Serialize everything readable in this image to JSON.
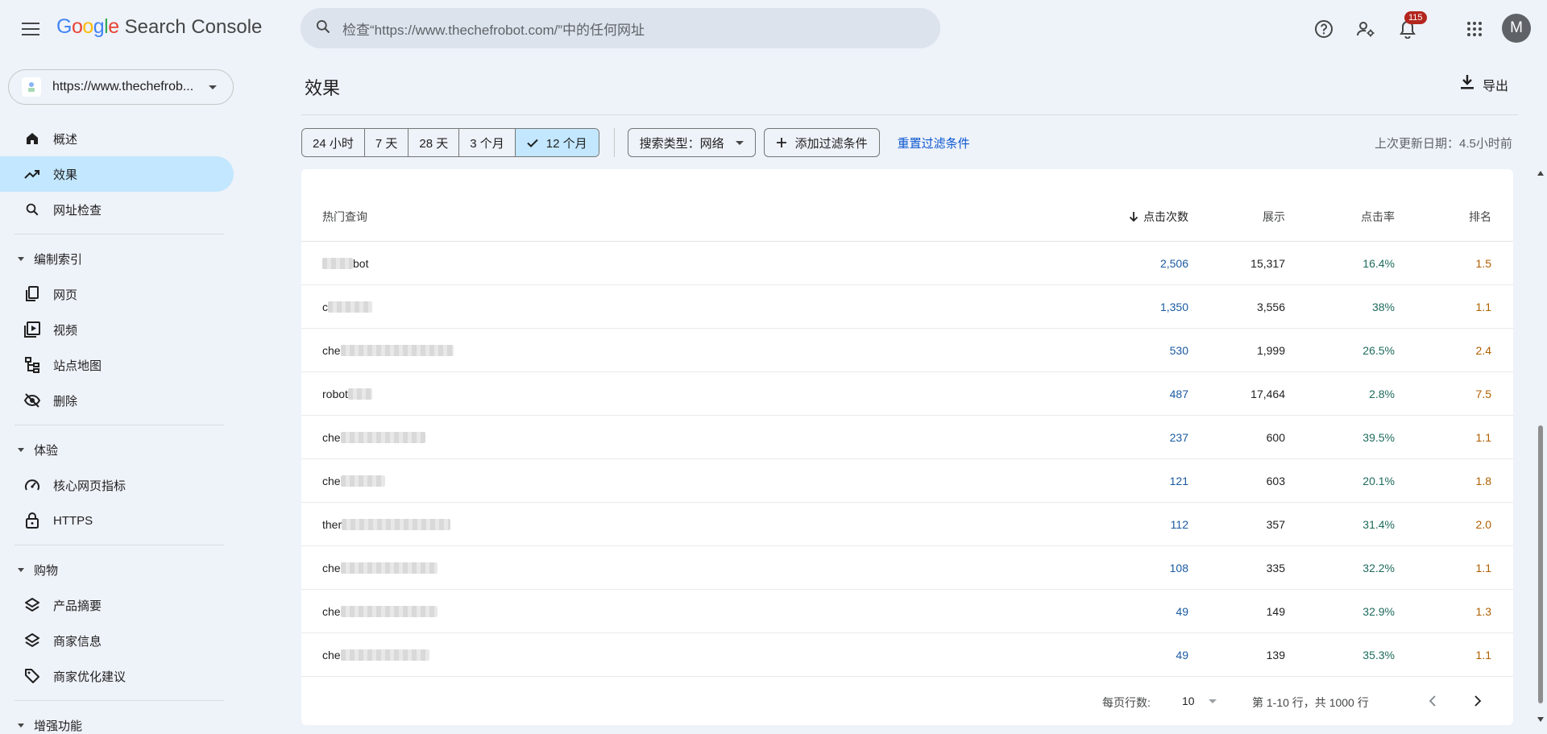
{
  "header": {
    "logo_google": "Google",
    "logo_product": "Search Console",
    "search_placeholder": "检查“https://www.thechefrobot.com/”中的任何网址",
    "notification_count": "115",
    "avatar_letter": "M"
  },
  "sidebar": {
    "property": "https://www.thechefrob...",
    "items_top": [
      {
        "label": "概述",
        "icon": "home-icon"
      },
      {
        "label": "效果",
        "icon": "trending-up-icon"
      },
      {
        "label": "网址检查",
        "icon": "search-icon"
      }
    ],
    "sections": [
      {
        "title": "编制索引",
        "items": [
          {
            "label": "网页",
            "icon": "pages-icon"
          },
          {
            "label": "视频",
            "icon": "video-icon"
          },
          {
            "label": "站点地图",
            "icon": "sitemap-icon"
          },
          {
            "label": "删除",
            "icon": "eye-off-icon"
          }
        ]
      },
      {
        "title": "体验",
        "items": [
          {
            "label": "核心网页指标",
            "icon": "speed-icon"
          },
          {
            "label": "HTTPS",
            "icon": "lock-icon"
          }
        ]
      },
      {
        "title": "购物",
        "items": [
          {
            "label": "产品摘要",
            "icon": "layers-icon"
          },
          {
            "label": "商家信息",
            "icon": "layers-icon"
          },
          {
            "label": "商家优化建议",
            "icon": "tag-icon"
          }
        ]
      },
      {
        "title": "增强功能",
        "items": []
      }
    ]
  },
  "main": {
    "title": "效果",
    "export_label": "导出",
    "date_ranges": [
      "24 小时",
      "7 天",
      "28 天",
      "3 个月",
      "12 个月"
    ],
    "selected_range": "12 个月",
    "search_type_label": "搜索类型：网络",
    "add_filter_label": "添加过滤条件",
    "reset_filter_label": "重置过滤条件",
    "last_update": "上次更新日期：4.5小时前"
  },
  "table": {
    "columns": {
      "query": "热门查询",
      "clicks": "点击次数",
      "impressions": "展示",
      "ctr": "点击率",
      "position": "排名"
    },
    "rows": [
      {
        "query_visible": "bot",
        "blur_width": 38,
        "blur_before": true,
        "clicks": "2,506",
        "impressions": "15,317",
        "ctr": "16.4%",
        "position": "1.5"
      },
      {
        "query_visible": "c",
        "blur_width": 55,
        "blur_before": false,
        "clicks": "1,350",
        "impressions": "3,556",
        "ctr": "38%",
        "position": "1.1"
      },
      {
        "query_visible": "che",
        "blur_width": 140,
        "blur_before": false,
        "clicks": "530",
        "impressions": "1,999",
        "ctr": "26.5%",
        "position": "2.4"
      },
      {
        "query_visible": "robot",
        "blur_width": 30,
        "blur_before": false,
        "clicks": "487",
        "impressions": "17,464",
        "ctr": "2.8%",
        "position": "7.5"
      },
      {
        "query_visible": "che",
        "blur_width": 105,
        "blur_before": false,
        "clicks": "237",
        "impressions": "600",
        "ctr": "39.5%",
        "position": "1.1"
      },
      {
        "query_visible": "che",
        "blur_width": 55,
        "blur_before": false,
        "clicks": "121",
        "impressions": "603",
        "ctr": "20.1%",
        "position": "1.8"
      },
      {
        "query_visible": "ther",
        "blur_width": 135,
        "blur_before": false,
        "clicks": "112",
        "impressions": "357",
        "ctr": "31.4%",
        "position": "2.0"
      },
      {
        "query_visible": "che",
        "blur_width": 120,
        "blur_before": false,
        "clicks": "108",
        "impressions": "335",
        "ctr": "32.2%",
        "position": "1.1"
      },
      {
        "query_visible": "che",
        "blur_width": 120,
        "blur_before": false,
        "clicks": "49",
        "impressions": "149",
        "ctr": "32.9%",
        "position": "1.3"
      },
      {
        "query_visible": "che",
        "blur_width": 110,
        "blur_before": false,
        "clicks": "49",
        "impressions": "139",
        "ctr": "35.3%",
        "position": "1.1"
      }
    ]
  },
  "pager": {
    "rows_per_page_label": "每页行数:",
    "rows_per_page": "10",
    "range": "第 1-10 行，共 1000 行"
  },
  "colors": {
    "active_nav": "#c2e7ff",
    "clicks": "#1a5aa0",
    "ctr": "#1e6b5c",
    "position": "#b06000",
    "link": "#0b57d0"
  }
}
